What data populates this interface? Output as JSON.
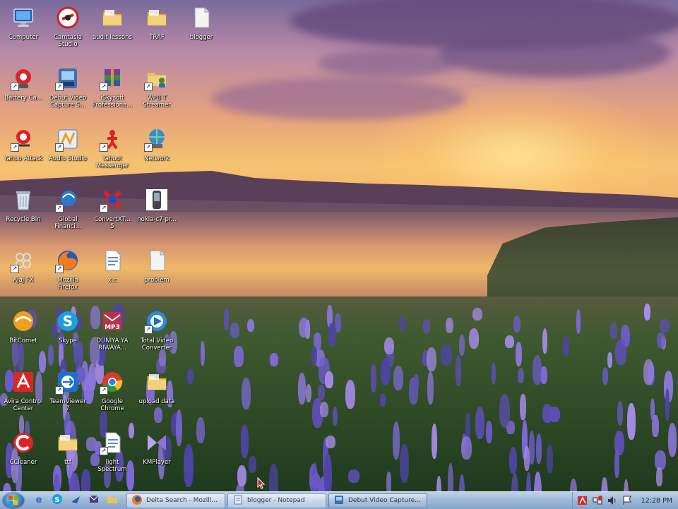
{
  "desktop": {
    "icons": [
      {
        "label": "Computer",
        "icon": "computer-icon"
      },
      {
        "label": "Camtasia\nStudio",
        "icon": "camtasia-icon"
      },
      {
        "label": "audit lessons",
        "icon": "folder-icon"
      },
      {
        "label": "TRAF",
        "icon": "folder-icon"
      },
      {
        "label": "blogger",
        "icon": "text-file-icon"
      },
      {
        "label": "Battery Ca...",
        "icon": "battery-care-icon"
      },
      {
        "label": "Debut Video\nCapture S...",
        "icon": "debut-video-icon"
      },
      {
        "label": "iSkysoft\nProfessiona...",
        "icon": "winrar-icon"
      },
      {
        "label": "WPB T\nStreamer",
        "icon": "folder-user-icon"
      },
      {
        "label": "Yahoo Attack",
        "icon": "yahoo-attack-icon"
      },
      {
        "label": "Audio Studio",
        "icon": "audio-studio-icon"
      },
      {
        "label": "Yahoo!\nMessenger",
        "icon": "yahoo-messenger-icon"
      },
      {
        "label": "Network",
        "icon": "network-icon"
      },
      {
        "label": "Recycle Bin",
        "icon": "recycle-bin-icon"
      },
      {
        "label": "Global\nFinanci...",
        "icon": "global-financial-icon"
      },
      {
        "label": "ConvertXT...\n5",
        "icon": "convertx-icon"
      },
      {
        "label": "nokia-c7-pr...",
        "icon": "nokia-phone-icon"
      },
      {
        "label": "Ajaj FX",
        "icon": "ajax-icon"
      },
      {
        "label": "Mozilla\nFirefox",
        "icon": "firefox-icon"
      },
      {
        "label": "x.c",
        "icon": "document-icon"
      },
      {
        "label": "problem",
        "icon": "text-file-icon"
      },
      {
        "label": "BitComet",
        "icon": "bitcomet-icon"
      },
      {
        "label": "Skype",
        "icon": "skype-icon"
      },
      {
        "label": "DUNIYA YA\nRIWAYA...",
        "icon": "mp3-icon"
      },
      {
        "label": "Total Video\nConverter",
        "icon": "video-converter-icon"
      },
      {
        "label": "Avira Control\nCenter",
        "icon": "avira-icon"
      },
      {
        "label": "TeamViewer\n7",
        "icon": "teamviewer-icon"
      },
      {
        "label": "Google\nChrome",
        "icon": "chrome-icon"
      },
      {
        "label": "upload data",
        "icon": "folder-icon"
      },
      {
        "label": "CCleaner",
        "icon": "ccleaner-icon"
      },
      {
        "label": "ttf",
        "icon": "folder-icon"
      },
      {
        "label": "light\nSpectrum",
        "icon": "document-icon"
      },
      {
        "label": "KMPlayer",
        "icon": "kmplayer-icon"
      }
    ]
  },
  "taskbar": {
    "quick_launch": [
      "ie-icon",
      "skype-icon",
      "explorer-icon",
      "messenger-icon",
      "folder-icon"
    ],
    "tasks": [
      {
        "label": "Delta Search - Mozill...",
        "icon": "firefox-icon",
        "active": false
      },
      {
        "label": "blogger - Notepad",
        "icon": "notepad-icon",
        "active": false
      },
      {
        "label": "Debut Video Capture...",
        "icon": "debut-video-icon",
        "active": true
      }
    ],
    "tray_icons": [
      "avira-tray-icon",
      "network-tray-icon",
      "volume-icon",
      "flag-icon"
    ],
    "clock": "12:28 PM"
  },
  "colors": {
    "taskbar": "#9fb9d8",
    "folder": "#e8c35a",
    "label_text": "#ffffff"
  }
}
